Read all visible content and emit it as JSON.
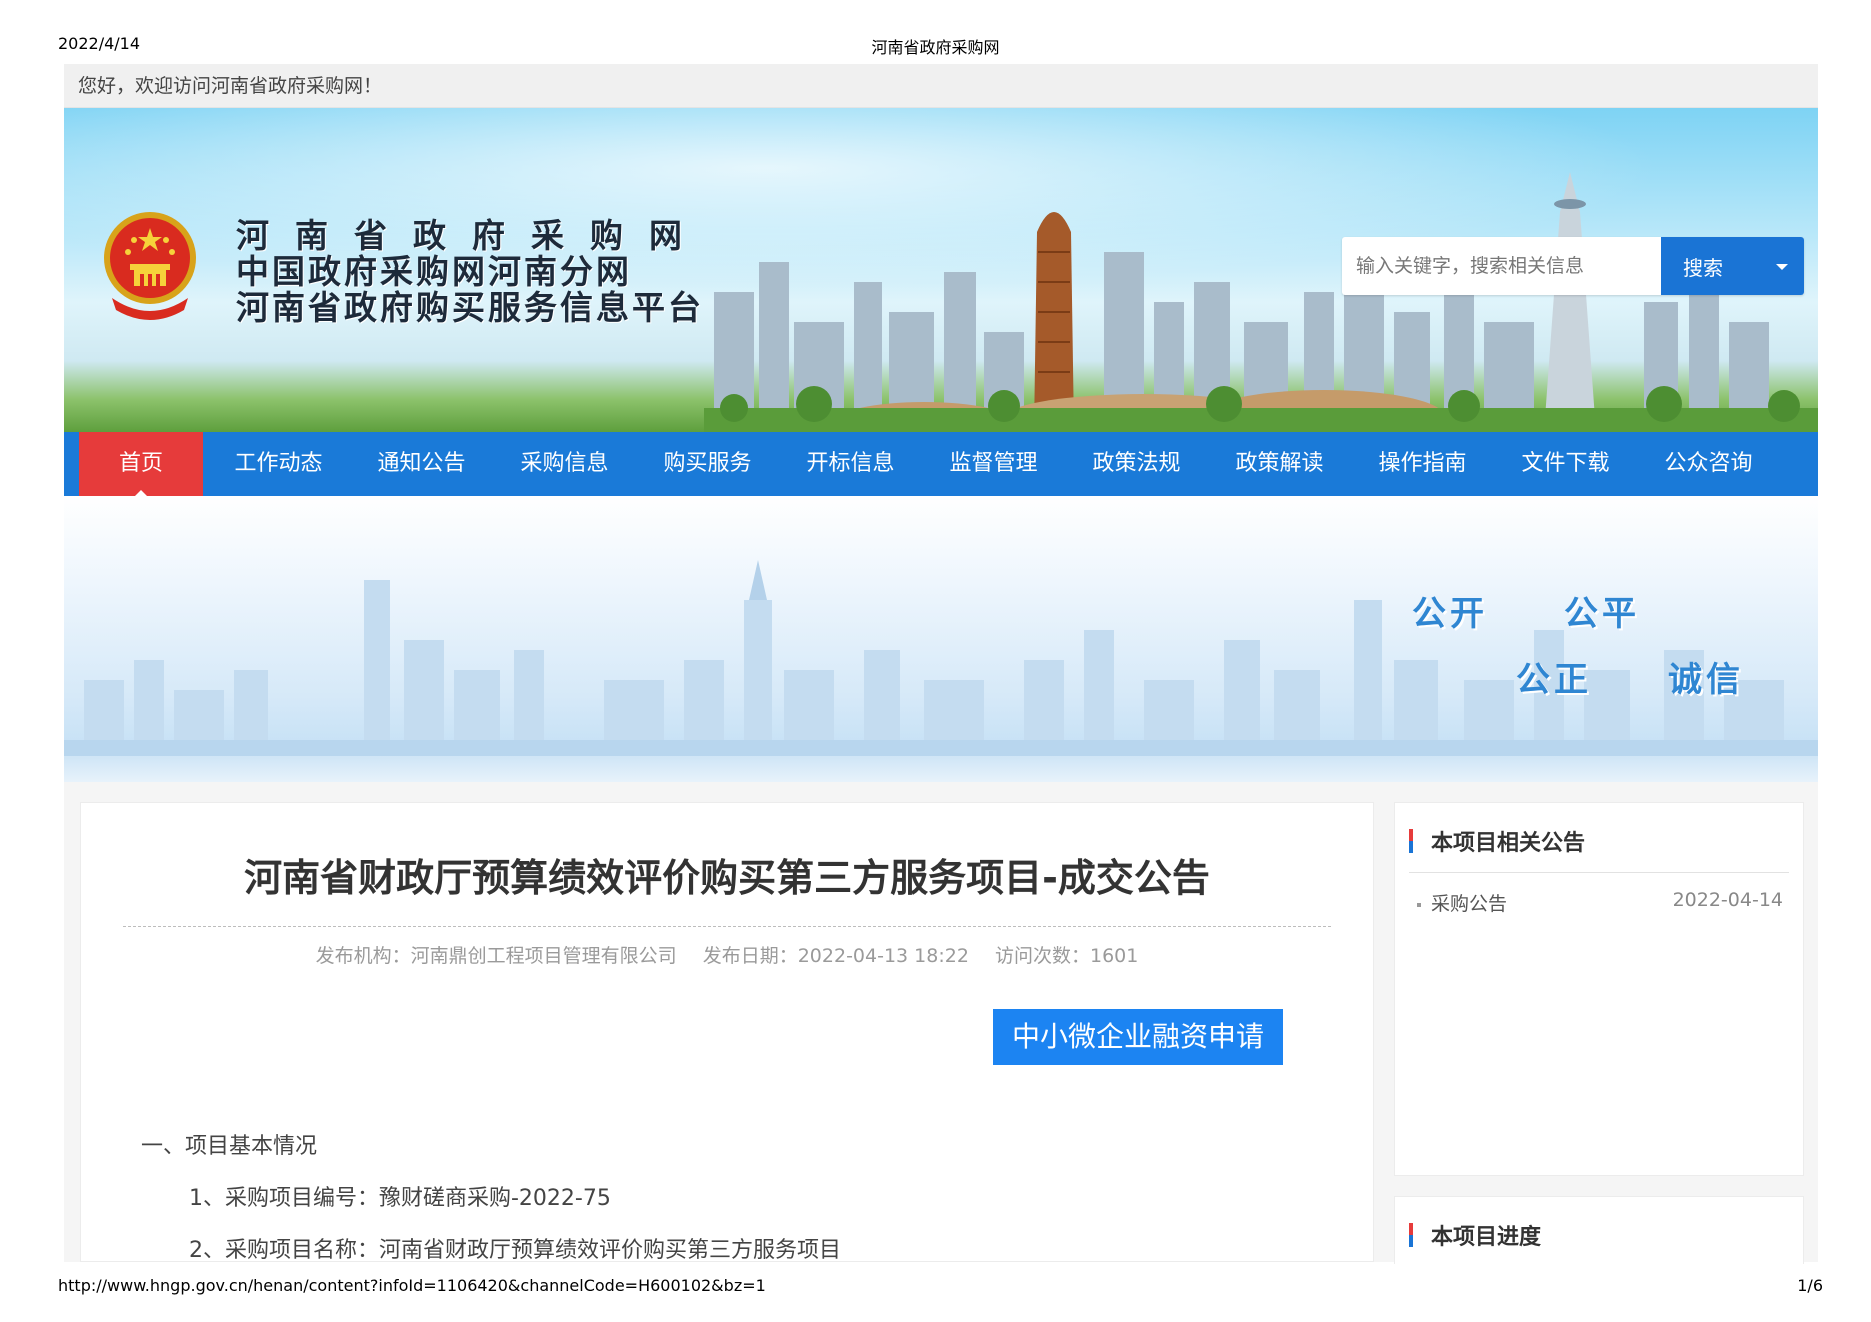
{
  "print_header": {
    "date": "2022/4/14",
    "title": "河南省政府采购网"
  },
  "print_footer": {
    "url": "http://www.hngp.gov.cn/henan/content?infoId=1106420&channelCode=H600102&bz=1",
    "page": "1/6"
  },
  "welcome_text": "您好，欢迎访问河南省政府采购网！",
  "banner": {
    "site_names": [
      "河南省政府采购网",
      "中国政府采购网河南分网",
      "河南省政府购买服务信息平台"
    ],
    "search_placeholder": "输入关键字，搜索相关信息",
    "search_button": "搜索"
  },
  "nav": {
    "items": [
      {
        "label": "首页",
        "active": true
      },
      {
        "label": "工作动态"
      },
      {
        "label": "通知公告"
      },
      {
        "label": "采购信息"
      },
      {
        "label": "购买服务"
      },
      {
        "label": "开标信息"
      },
      {
        "label": "监督管理"
      },
      {
        "label": "政策法规"
      },
      {
        "label": "政策解读"
      },
      {
        "label": "操作指南"
      },
      {
        "label": "文件下载"
      },
      {
        "label": "公众咨询"
      }
    ]
  },
  "slogans": [
    "公开",
    "公平",
    "公正",
    "诚信"
  ],
  "article": {
    "title": "河南省财政厅预算绩效评价购买第三方服务项目-成交公告",
    "publisher": "发布机构：河南鼎创工程项目管理有限公司",
    "publish_date": "发布日期：2022-04-13 18:22",
    "visits": "访问次数：1601",
    "finance_button": "中小微企业融资申请",
    "section1": "一、项目基本情况",
    "item1": "1、采购项目编号：豫财磋商采购-2022-75",
    "item2": "2、采购项目名称：河南省财政厅预算绩效评价购买第三方服务项目"
  },
  "sidebar": {
    "related_title": "本项目相关公告",
    "related_items": [
      {
        "label": "采购公告",
        "date": "2022-04-14"
      }
    ],
    "progress_title": "本项目进度"
  },
  "colors": {
    "nav_blue": "#1a7ad8",
    "active_red": "#e63b3b",
    "button_blue": "#1c84f2",
    "search_blue": "#1a74d5"
  }
}
